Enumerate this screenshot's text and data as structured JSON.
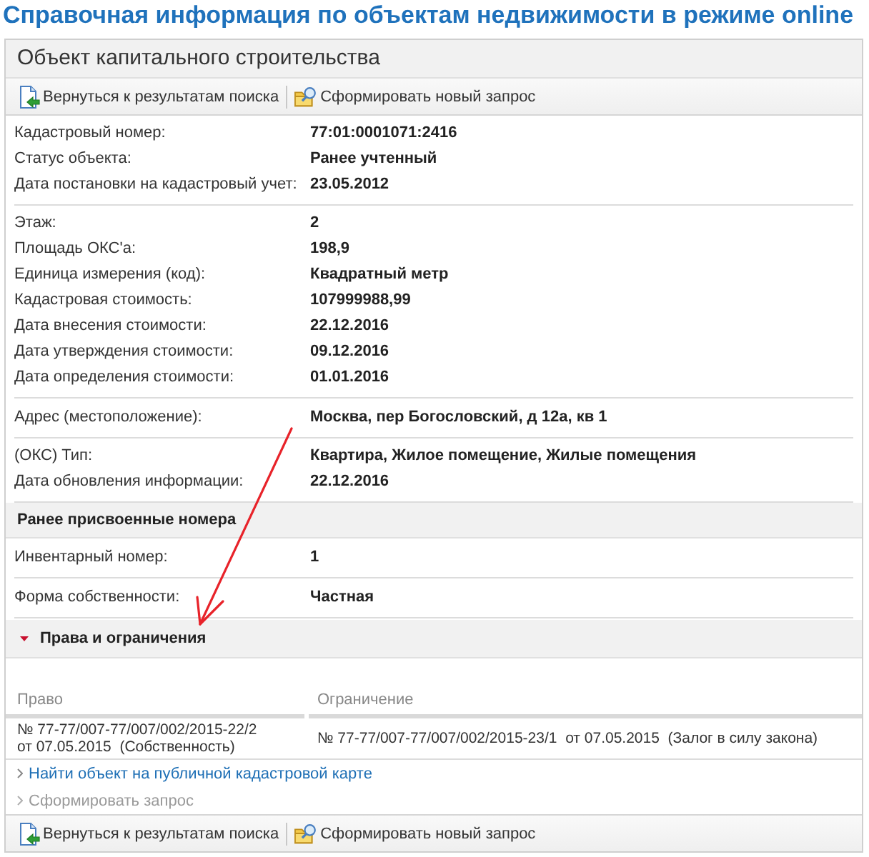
{
  "page_title": "Справочная информация по объектам недвижимости в режиме online",
  "panel": {
    "title": "Объект капитального строительства"
  },
  "toolbar_top": [
    {
      "kind": "back",
      "label": "Вернуться к результатам поиска"
    },
    {
      "kind": "new_request",
      "label": "Сформировать новый запрос"
    }
  ],
  "sections": [
    {
      "kind": "fields",
      "rows": [
        {
          "label": "Кадастровый номер:",
          "value": "77:01:0001071:2416"
        },
        {
          "label": "Статус объекта:",
          "value": "Ранее учтенный"
        },
        {
          "label": "Дата постановки на кадастровый учет:",
          "value": "23.05.2012"
        }
      ]
    },
    {
      "kind": "fields",
      "rows": [
        {
          "label": "Этаж:",
          "value": "2"
        },
        {
          "label": "Площадь ОКС'а:",
          "value": "198,9"
        },
        {
          "label": "Единица измерения (код):",
          "value": "Квадратный метр"
        },
        {
          "label": "Кадастровая стоимость:",
          "value": "107999988,99"
        },
        {
          "label": "Дата внесения стоимости:",
          "value": "22.12.2016"
        },
        {
          "label": "Дата утверждения стоимости:",
          "value": "09.12.2016"
        },
        {
          "label": "Дата определения стоимости:",
          "value": "01.01.2016"
        }
      ]
    },
    {
      "kind": "fields",
      "rows": [
        {
          "label": "Адрес (местоположение):",
          "value": "Москва, пер Богословский, д 12а, кв 1"
        }
      ]
    },
    {
      "kind": "fields",
      "rows": [
        {
          "label": "(ОКС) Тип:",
          "value": "Квартира, Жилое помещение, Жилые помещения"
        },
        {
          "label": "Дата обновления информации:",
          "value": "22.12.2016"
        }
      ]
    },
    {
      "kind": "heading",
      "title": "Ранее присвоенные номера"
    },
    {
      "kind": "fields",
      "rows": [
        {
          "label": "Инвентарный номер:",
          "value": "1"
        }
      ]
    },
    {
      "kind": "fields",
      "rows": [
        {
          "label": "Форма собственности:",
          "value": "Частная"
        }
      ]
    }
  ],
  "rights": {
    "title": "Права и ограничения",
    "expanded": true,
    "columns": [
      "Право",
      "Ограничение"
    ],
    "rows": [
      [
        "№ 77-77/007-77/007/002/2015-22/2  от 07.05.2015  (Собственность)",
        "№ 77-77/007-77/007/002/2015-23/1  от 07.05.2015  (Залог в силу закона)"
      ]
    ]
  },
  "links": [
    {
      "label": "Найти объект на публичной кадастровой карте",
      "disabled": false
    },
    {
      "label": "Сформировать запрос",
      "disabled": true
    }
  ],
  "toolbar_bottom": [
    {
      "kind": "back",
      "label": "Вернуться к результатам поиска"
    },
    {
      "kind": "new_request",
      "label": "Сформировать новый запрос"
    }
  ]
}
